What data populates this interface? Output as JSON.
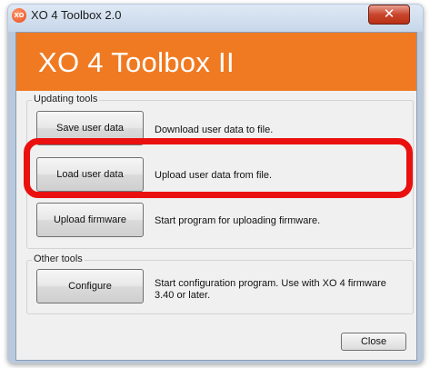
{
  "window": {
    "title": "XO 4 Toolbox 2.0",
    "app_icon_text": "XO",
    "close_glyph": "✕"
  },
  "banner": {
    "title": "XO 4 Toolbox II",
    "color": "#f07a22"
  },
  "updating_tools": {
    "label": "Updating tools",
    "items": [
      {
        "button": "Save user data",
        "description": "Download user data to file."
      },
      {
        "button": "Load user data",
        "description": "Upload user data from file."
      },
      {
        "button": "Upload firmware",
        "description": "Start program for uploading firmware."
      }
    ]
  },
  "other_tools": {
    "label": "Other tools",
    "items": [
      {
        "button": "Configure",
        "description": "Start configuration program. Use with XO 4 firmware 3.40 or later."
      }
    ]
  },
  "footer": {
    "close_label": "Close"
  },
  "annotation_color": "#ea1010"
}
